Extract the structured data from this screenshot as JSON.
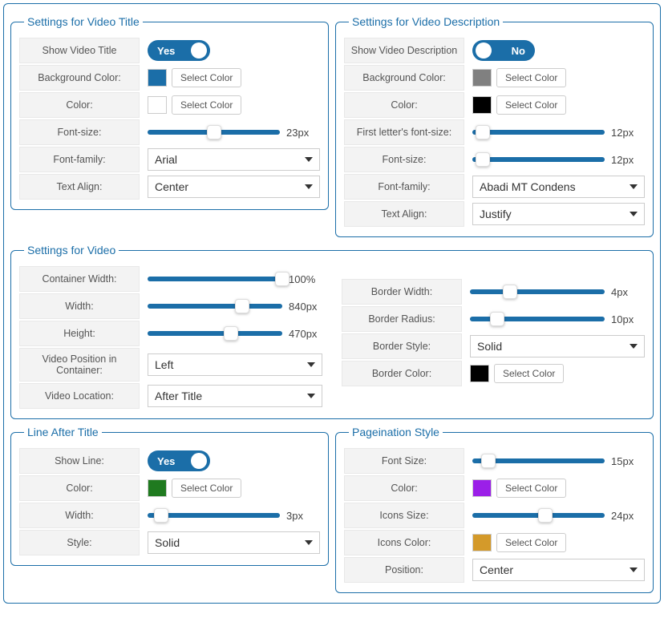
{
  "selectColor": "Select Color",
  "videoTitle": {
    "legend": "Settings for Video Title",
    "showLabel": "Show Video Title",
    "showValue": "Yes",
    "bgLabel": "Background Color:",
    "bgColor": "#1b6ea8",
    "colorLabel": "Color:",
    "color": "#ffffff",
    "fontSizeLabel": "Font-size:",
    "fontSizeValue": "23px",
    "fontSizePercent": 50,
    "fontFamilyLabel": "Font-family:",
    "fontFamilyValue": "Arial",
    "textAlignLabel": "Text Align:",
    "textAlignValue": "Center"
  },
  "videoDesc": {
    "legend": "Settings for Video Description",
    "showLabel": "Show Video Description",
    "showValue": "No",
    "bgLabel": "Background Color:",
    "bgColor": "#808080",
    "colorLabel": "Color:",
    "color": "#000000",
    "firstLetterLabel": "First letter's font-size:",
    "firstLetterValue": "12px",
    "firstLetterPercent": 8,
    "fontSizeLabel": "Font-size:",
    "fontSizeValue": "12px",
    "fontSizePercent": 8,
    "fontFamilyLabel": "Font-family:",
    "fontFamilyValue": "Abadi MT Condens",
    "textAlignLabel": "Text Align:",
    "textAlignValue": "Justify"
  },
  "video": {
    "legend": "Settings for Video",
    "containerWidthLabel": "Container Width:",
    "containerWidthValue": "100%",
    "containerWidthPercent": 100,
    "widthLabel": "Width:",
    "widthValue": "840px",
    "widthPercent": 70,
    "heightLabel": "Height:",
    "heightValue": "470px",
    "heightPercent": 62,
    "posLabel": "Video Position in Container:",
    "posValue": "Left",
    "locLabel": "Video Location:",
    "locValue": "After Title",
    "borderWidthLabel": "Border Width:",
    "borderWidthValue": "4px",
    "borderWidthPercent": 30,
    "borderRadiusLabel": "Border Radius:",
    "borderRadiusValue": "10px",
    "borderRadiusPercent": 20,
    "borderStyleLabel": "Border Style:",
    "borderStyleValue": "Solid",
    "borderColorLabel": "Border Color:",
    "borderColor": "#000000"
  },
  "lineAfter": {
    "legend": "Line After Title",
    "showLabel": "Show Line:",
    "showValue": "Yes",
    "colorLabel": "Color:",
    "color": "#1f7a1f",
    "widthLabel": "Width:",
    "widthValue": "3px",
    "widthPercent": 10,
    "styleLabel": "Style:",
    "styleValue": "Solid"
  },
  "pagination": {
    "legend": "Pageination Style",
    "fontSizeLabel": "Font Size:",
    "fontSizeValue": "15px",
    "fontSizePercent": 12,
    "colorLabel": "Color:",
    "color": "#9b1fe8",
    "iconsSizeLabel": "Icons Size:",
    "iconsSizeValue": "24px",
    "iconsSizePercent": 55,
    "iconsColorLabel": "Icons Color:",
    "iconsColor": "#d49a2a",
    "posLabel": "Position:",
    "posValue": "Center"
  }
}
